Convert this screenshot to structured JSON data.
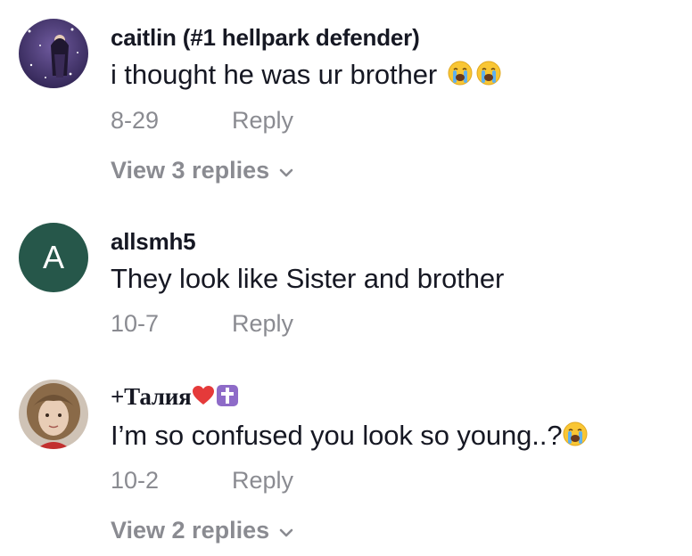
{
  "comments": [
    {
      "username": "caitlin (#1 hellpark defender)",
      "text": "i thought he was ur brother",
      "emoji_icons": [
        "loudly-crying-face-icon",
        "loudly-crying-face-icon"
      ],
      "date": "8-29",
      "reply_label": "Reply",
      "view_replies": "View 3 replies"
    },
    {
      "username": "allsmh5",
      "avatar_letter": "A",
      "avatar_color": "#26574a",
      "text": "They look like Sister and brother",
      "date": "10-7",
      "reply_label": "Reply"
    },
    {
      "username": "+Талия",
      "username_emoji_icons": [
        "red-heart-icon",
        "latin-cross-icon"
      ],
      "text": "I’m so confused you look so young..?",
      "emoji_icons": [
        "loudly-crying-face-icon"
      ],
      "date": "10-2",
      "reply_label": "Reply",
      "view_replies": "View 2 replies"
    }
  ],
  "colors": {
    "text": "#161823",
    "meta": "#8a8b91",
    "emoji_face": "#f9c634",
    "heart": "#e53a3a",
    "cross_badge": "#8e6bc8"
  }
}
